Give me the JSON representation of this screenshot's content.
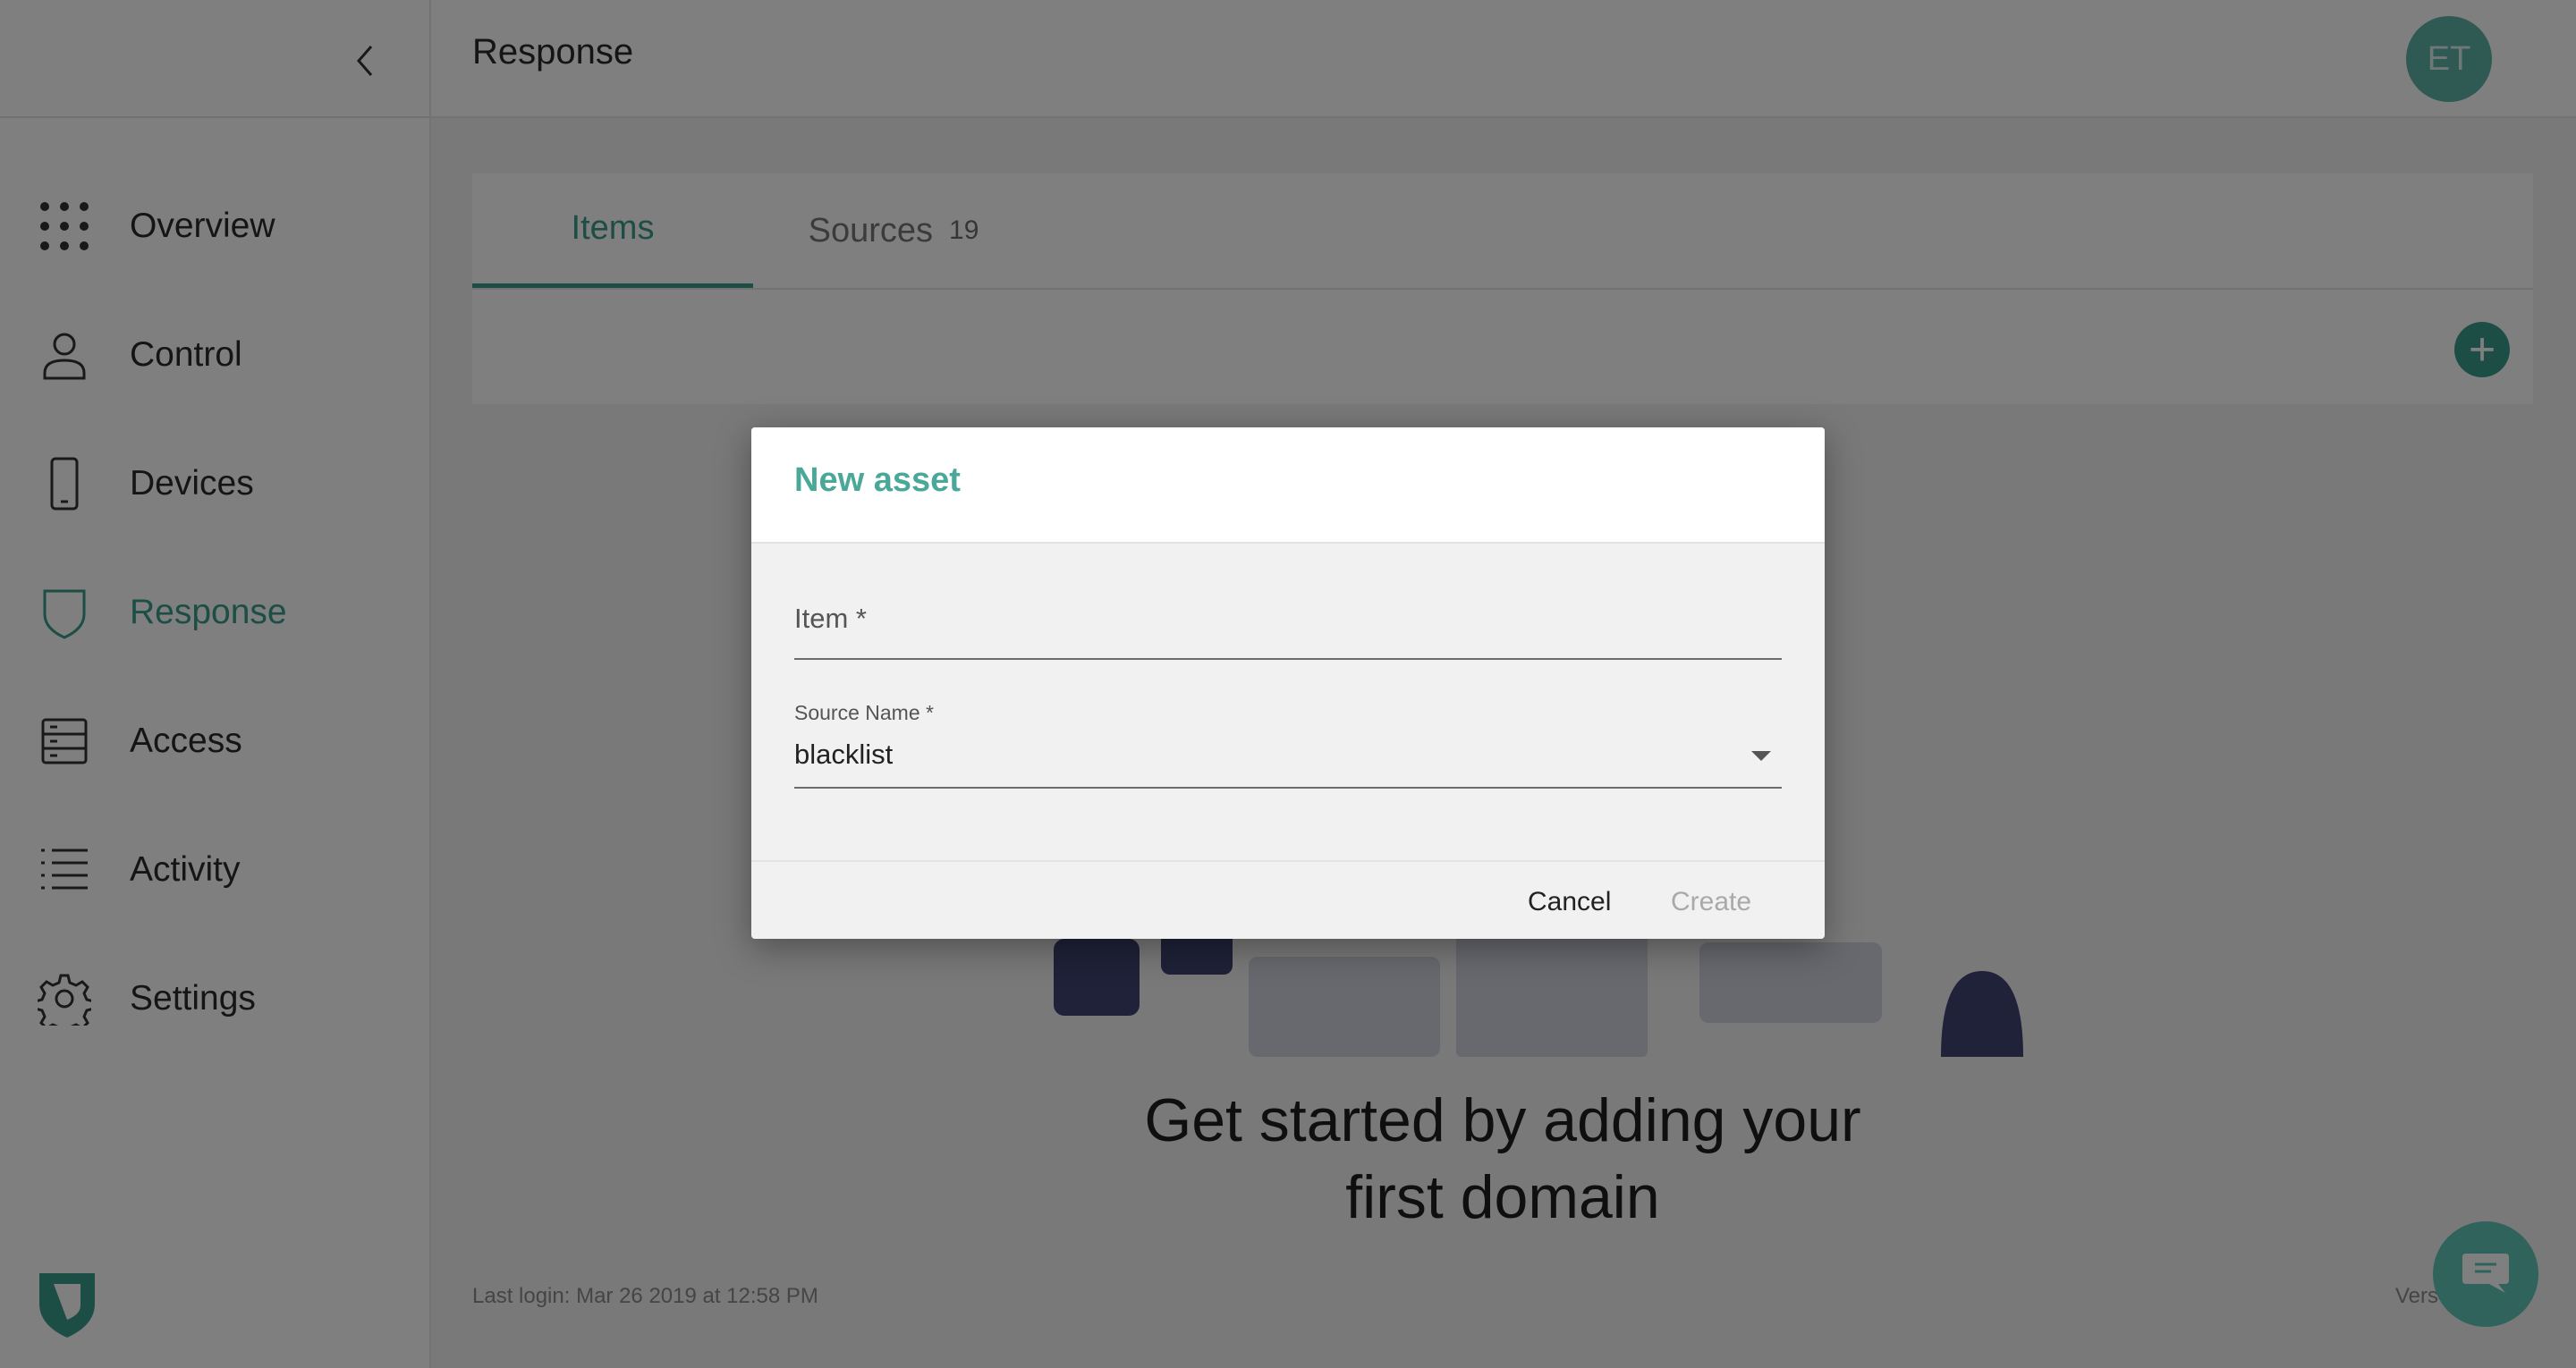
{
  "header": {
    "title": "Response",
    "avatar_initials": "ET"
  },
  "sidebar": {
    "items": [
      {
        "label": "Overview",
        "icon": "grid-dots-icon",
        "active": false
      },
      {
        "label": "Control",
        "icon": "person-icon",
        "active": false
      },
      {
        "label": "Devices",
        "icon": "phone-icon",
        "active": false
      },
      {
        "label": "Response",
        "icon": "shield-icon",
        "active": true
      },
      {
        "label": "Access",
        "icon": "server-icon",
        "active": false
      },
      {
        "label": "Activity",
        "icon": "list-icon",
        "active": false
      },
      {
        "label": "Settings",
        "icon": "gear-icon",
        "active": false
      }
    ]
  },
  "tabs": [
    {
      "label": "Items",
      "count": "",
      "active": true
    },
    {
      "label": "Sources",
      "count": "19",
      "active": false
    }
  ],
  "empty_state": {
    "message_line1": "Get started by adding your",
    "message_line2": "first domain"
  },
  "footer": {
    "last_login": "Last login: Mar 26 2019 at 12:58 PM",
    "version": "Vers"
  },
  "dialog": {
    "title": "New asset",
    "item_label": "Item *",
    "item_value": "",
    "source_label": "Source Name *",
    "source_value": "blacklist",
    "cancel_label": "Cancel",
    "create_label": "Create"
  },
  "colors": {
    "accent": "#3a9c8c",
    "dialog_title": "#4aa898",
    "chat_button": "#5fc7b7",
    "avatar": "#5fb3a7"
  }
}
